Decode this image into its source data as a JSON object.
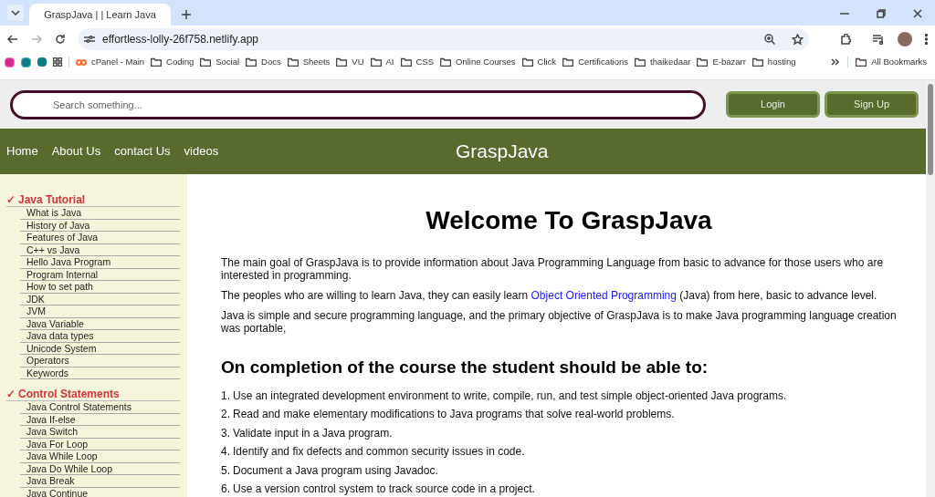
{
  "browser": {
    "tab_title": "GraspJava | | Learn Java",
    "url": "effortless-lolly-26f758.netlify.app",
    "bookmarks": [
      {
        "label": "cPanel - Main",
        "kind": "cpanel"
      },
      {
        "label": "Coding",
        "kind": "folder"
      },
      {
        "label": "Social",
        "kind": "folder"
      },
      {
        "label": "Docs",
        "kind": "folder"
      },
      {
        "label": "Sheets",
        "kind": "folder"
      },
      {
        "label": "VU",
        "kind": "folder"
      },
      {
        "label": "AI",
        "kind": "folder"
      },
      {
        "label": "CSS",
        "kind": "folder"
      },
      {
        "label": "Online Courses",
        "kind": "folder"
      },
      {
        "label": "Click",
        "kind": "folder"
      },
      {
        "label": "Certifications",
        "kind": "folder"
      },
      {
        "label": "thaikedaar",
        "kind": "folder"
      },
      {
        "label": "E-bazarr",
        "kind": "folder"
      },
      {
        "label": "hosting",
        "kind": "folder"
      }
    ],
    "all_bookmarks": "All Bookmarks"
  },
  "header": {
    "search": {
      "placeholder": "Search something..."
    },
    "buttons": [
      "Login",
      "Sign Up"
    ]
  },
  "nav": {
    "links": [
      "Home",
      "About Us",
      "contact Us",
      "videos"
    ],
    "brand": "GraspJava"
  },
  "sidebar": {
    "sections": [
      {
        "mark": "✓",
        "title": "Java Tutorial",
        "items": [
          "What is Java",
          "History of Java",
          "Features of Java",
          "C++ vs Java",
          "Hello Java Program",
          "Program Internal",
          "How to set path",
          "JDK",
          "JVM",
          "Java Variable",
          "Java data types",
          "Unicode System",
          "Operators",
          "Keywords"
        ]
      },
      {
        "mark": "✓",
        "title": "Control Statements",
        "items": [
          "Java Control Statements",
          "Java If-else",
          "Java Switch",
          "Java For Loop",
          "Java While Loop",
          "Java Do While Loop",
          "Java Break",
          "Java Continue"
        ]
      }
    ]
  },
  "main": {
    "title": "Welcome To GraspJava",
    "paragraphs": [
      [
        {
          "text": "The main goal of GraspJava is to provide information about Java Programming Language from basic to advance for those users who are interested in programming.",
          "kind": "text"
        }
      ],
      [
        {
          "text": "The peoples who are willing to learn Java, they can easily learn ",
          "kind": "text"
        },
        {
          "text": "Object Oriented Programming",
          "kind": "link"
        },
        {
          "text": " (Java) from here, basic to advance level.",
          "kind": "text"
        }
      ],
      [
        {
          "text": "Java is simple and secure programming language, and the primary objective of GraspJava is to make Java programming language creation was portable,",
          "kind": "text"
        }
      ]
    ],
    "subtitle": "On completion of the course the student should be able to:",
    "outcomes": [
      {
        "number": "1.",
        "text": "Use an integrated development environment to write, compile, run, and test simple object-oriented Java programs."
      },
      {
        "number": "2.",
        "text": "Read and make elementary modifications to Java programs that solve real-world problems."
      },
      {
        "number": "3.",
        "text": "Validate input in a Java program."
      },
      {
        "number": "4.",
        "text": "Identify and fix defects and common security issues in code."
      },
      {
        "number": "5.",
        "text": "Document a Java program using Javadoc."
      },
      {
        "number": "6.",
        "text": "Use a version control system to track source code in a project."
      }
    ]
  }
}
